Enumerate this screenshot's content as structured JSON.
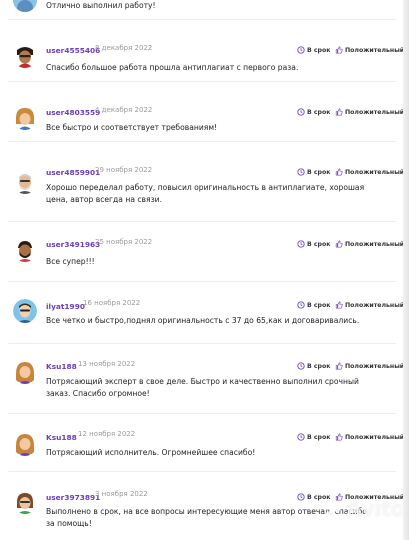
{
  "reviews": [
    {
      "user": "",
      "date": "",
      "text": "Отлично выполнил работу!"
    },
    {
      "user": "user4555406",
      "date": "8 декабря 2022",
      "text": "Спасибо большое работа прошла антиплагиат с первого раза."
    },
    {
      "user": "user4803559",
      "date": "4 декабря 2022",
      "text": "Все быстро и соответствует требованиям!"
    },
    {
      "user": "user4859901",
      "date": "29 ноября 2022",
      "text": "Хорошо переделал работу, повысил оригинальность в антиплагиате, хорошая цена, автор всегда на связи."
    },
    {
      "user": "user3491963",
      "date": "25 ноября 2022",
      "text": "Все супер!!!"
    },
    {
      "user": "ilyat1990",
      "date": "16 ноября 2022",
      "text": "Все четко и быстро,поднял оригинальность с 37 до 65,как и договаривались."
    },
    {
      "user": "Ksu188",
      "date": "13 ноября 2022",
      "text": "Потрясающий эксперт в свое деле. Быстро и качественно выполнил срочный заказ. Спасибо огромное!"
    },
    {
      "user": "Ksu188",
      "date": "12 ноября 2022",
      "text": "Потрясающий исполнитель. Огромнейшее спасибо!"
    },
    {
      "user": "user3973891",
      "date": "3 ноября 2022",
      "text": "Выполнено в срок, на все вопросы интересующие меня автор отвечал, спасибо за помощь!"
    }
  ],
  "badges": {
    "ontime": "В срок",
    "positive": "Положительный"
  },
  "watermark": "Avito",
  "colors": {
    "username": "#6a3fb8",
    "date": "#9a9a9a",
    "divider": "#ececec"
  }
}
